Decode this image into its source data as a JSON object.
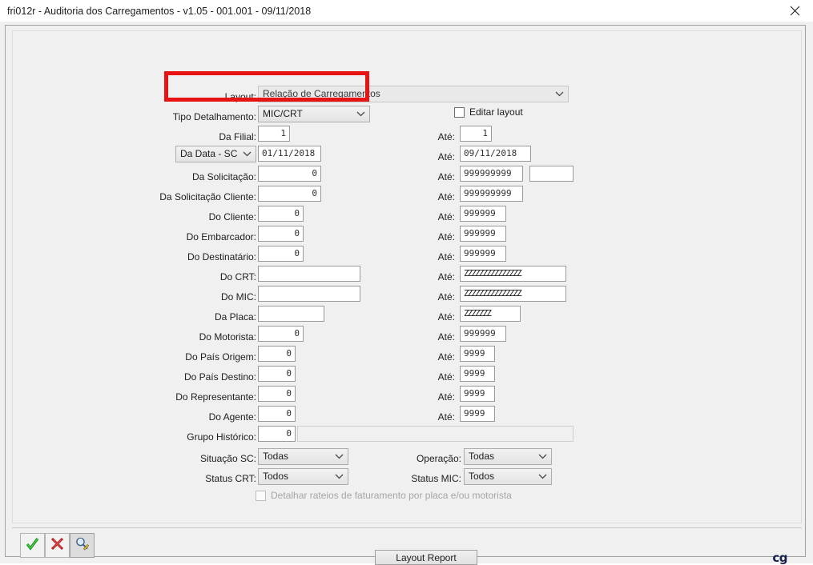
{
  "window": {
    "title": "fri012r - Auditoria dos Carregamentos - v1.05 - 001.001 - 09/11/2018",
    "close_icon": "close-icon"
  },
  "form": {
    "layout": {
      "label": "Layout:",
      "value": "Relação de Carregamentos"
    },
    "tipo_detalhamento": {
      "label": "Tipo Detalhamento:",
      "value": "MIC/CRT"
    },
    "editar_layout": {
      "label": "Editar layout",
      "checked": false
    },
    "ate_label": "Até:",
    "rows": [
      {
        "label": "Da Filial:",
        "from": "1",
        "to": "1"
      },
      {
        "label": "Da Data - SC",
        "from": "01/11/2018",
        "to": "09/11/2018"
      },
      {
        "label": "Da Solicitação:",
        "from": "0",
        "to": "999999999",
        "extra": ""
      },
      {
        "label": "Da Solicitação Cliente:",
        "from": "0",
        "to": "999999999"
      },
      {
        "label": "Do Cliente:",
        "from": "0",
        "to": "999999"
      },
      {
        "label": "Do Embarcador:",
        "from": "0",
        "to": "999999"
      },
      {
        "label": "Do Destinatário:",
        "from": "0",
        "to": "999999"
      },
      {
        "label": "Do CRT:",
        "from": "",
        "to": "ZZZZZZZZZZZZZZZ"
      },
      {
        "label": "Do MIC:",
        "from": "",
        "to": "ZZZZZZZZZZZZZZZ"
      },
      {
        "label": "Da Placa:",
        "from": "",
        "to": "ZZZZZZZ"
      },
      {
        "label": "Do Motorista:",
        "from": "0",
        "to": "999999"
      },
      {
        "label": "Do País Origem:",
        "from": "0",
        "to": "9999"
      },
      {
        "label": "Do País Destino:",
        "from": "0",
        "to": "9999"
      },
      {
        "label": "Do Representante:",
        "from": "0",
        "to": "9999"
      },
      {
        "label": "Do Agente:",
        "from": "0",
        "to": "9999"
      },
      {
        "label": "Grupo Histórico:",
        "from": "0",
        "to": ""
      }
    ],
    "selects": {
      "situacao_sc": {
        "label": "Situação SC:",
        "value": "Todas"
      },
      "operacao": {
        "label": "Operação:",
        "value": "Todas"
      },
      "status_crt": {
        "label": "Status CRT:",
        "value": "Todos"
      },
      "status_mic": {
        "label": "Status MIC:",
        "value": "Todos"
      }
    },
    "detalhar_rateios": {
      "label": "Detalhar rateios de faturamento por placa e/ou motorista",
      "checked": false,
      "disabled": true
    }
  },
  "toolbar": {
    "confirm_icon": "check-icon",
    "cancel_icon": "cancel-x-icon",
    "search_icon": "magnifier-edit-icon",
    "layout_report_label": "Layout Report",
    "brand": "cg"
  },
  "colors": {
    "highlight": "#e81313",
    "window_bg": "#f0f0f0",
    "brand": "#16204a"
  }
}
